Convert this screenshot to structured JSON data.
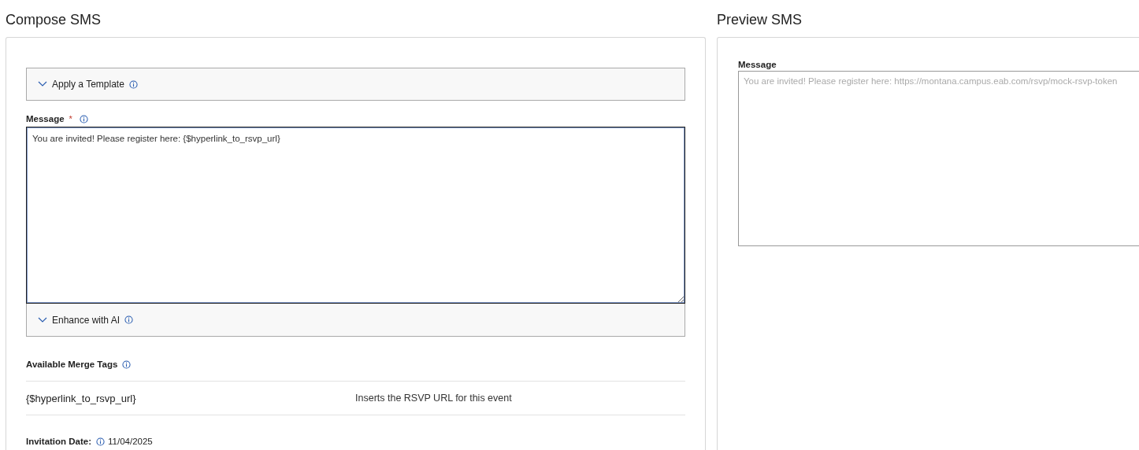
{
  "compose": {
    "title": "Compose SMS",
    "template_section": {
      "label": "Apply a Template",
      "expanded": false
    },
    "message": {
      "label": "Message",
      "required_mark": "*",
      "value": "You are invited! Please register here: {$hyperlink_to_rsvp_url}"
    },
    "ai_section": {
      "label": "Enhance with AI",
      "expanded": false
    },
    "merge_tags": {
      "title": "Available Merge Tags",
      "tags": [
        {
          "tag": "{$hyperlink_to_rsvp_url}",
          "description": "Inserts the RSVP URL for this event"
        }
      ]
    },
    "invitation_date": {
      "label": "Invitation Date:",
      "value": "11/04/2025"
    }
  },
  "preview": {
    "title": "Preview SMS",
    "message": {
      "label": "Message",
      "value": "You are invited! Please register here: https://montana.campus.eab.com/rsvp/mock-rsvp-token",
      "disabled": true
    }
  }
}
